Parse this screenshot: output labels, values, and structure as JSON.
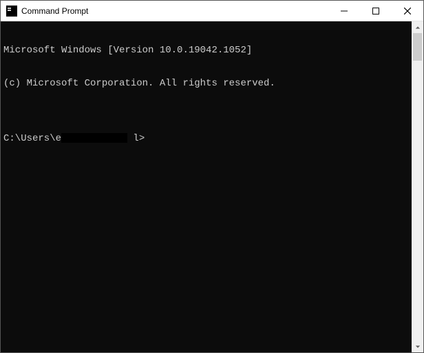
{
  "window": {
    "title": "Command Prompt"
  },
  "terminal": {
    "line1": "Microsoft Windows [Version 10.0.19042.1052]",
    "line2": "(c) Microsoft Corporation. All rights reserved.",
    "blank": "",
    "prompt_prefix": "C:\\Users\\e",
    "prompt_suffix": " l>"
  }
}
